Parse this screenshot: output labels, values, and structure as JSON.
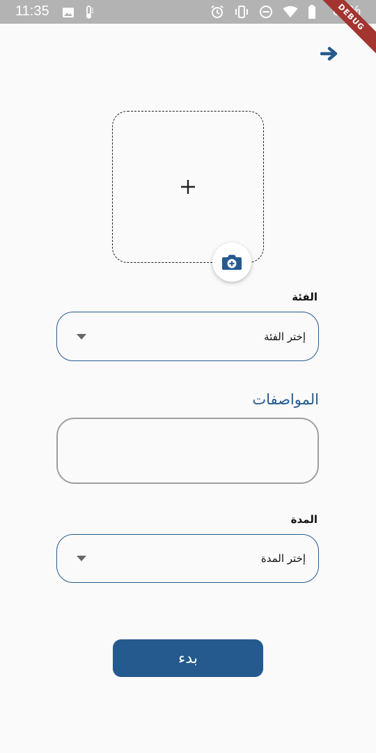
{
  "status_bar": {
    "time": "11:35",
    "battery": "83%",
    "debug_badge": "DEBUG",
    "left_icons": [
      "image-icon",
      "thermometer-icon"
    ],
    "right_icons": [
      "alarm-icon",
      "vibrate-icon",
      "do-not-disturb-icon",
      "wifi-icon",
      "battery-icon"
    ]
  },
  "header": {
    "forward_icon": "arrow-right-icon"
  },
  "image_picker": {
    "plus_icon": "plus-icon",
    "camera_icon": "camera-icon"
  },
  "form": {
    "category_label": "الفئة",
    "category_placeholder": "إختر الفئة",
    "specs_label": "المواصفات",
    "specs_value": "",
    "duration_label": "المدة",
    "duration_placeholder": "إختر المدة",
    "submit_label": "بدء"
  },
  "colors": {
    "primary": "#255a8e",
    "background": "#fafafa",
    "status_bar": "#b3b3b3",
    "debug_ribbon": "#a3342f"
  }
}
